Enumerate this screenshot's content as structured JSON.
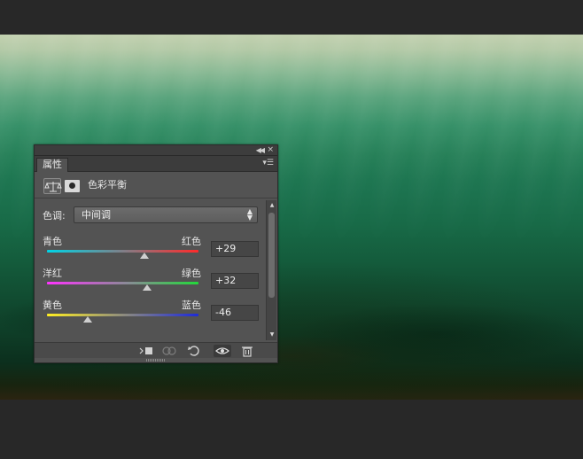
{
  "panel": {
    "tab_label": "属性",
    "title": "色彩平衡",
    "header_icons": [
      "balance-scale-icon",
      "layer-mask-icon"
    ],
    "tone": {
      "label": "色调:",
      "selected": "中间调"
    },
    "sliders": [
      {
        "left_label": "青色",
        "right_label": "红色",
        "value": "+29",
        "fraction": 0.645,
        "track_colors": [
          "#00d4e6",
          "#ff2a2a"
        ]
      },
      {
        "left_label": "洋红",
        "right_label": "绿色",
        "value": "+32",
        "fraction": 0.66,
        "track_colors": [
          "#ff33ff",
          "#22d93a"
        ]
      },
      {
        "left_label": "黄色",
        "right_label": "蓝色",
        "value": "-46",
        "fraction": 0.27,
        "track_colors": [
          "#ffee22",
          "#1e2bd9"
        ]
      }
    ],
    "footer_icons": [
      "clip-to-layer-icon",
      "view-previous-icon",
      "reset-icon",
      "visibility-icon",
      "trash-icon"
    ]
  }
}
